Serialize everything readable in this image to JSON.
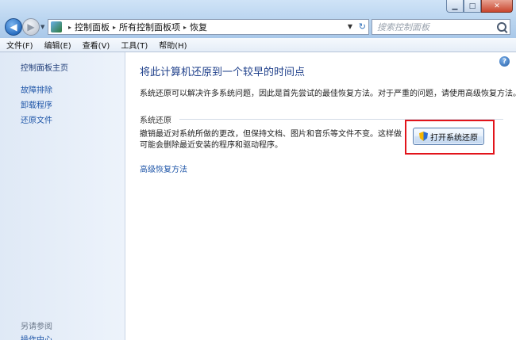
{
  "window": {
    "controls": {
      "minimize": "▁",
      "maximize": "□",
      "close": "✕"
    }
  },
  "address_bar": {
    "segments": [
      "控制面板",
      "所有控制面板项",
      "恢复"
    ],
    "separator": "▸"
  },
  "search": {
    "placeholder": "搜索控制面板"
  },
  "menu": [
    "文件(F)",
    "编辑(E)",
    "查看(V)",
    "工具(T)",
    "帮助(H)"
  ],
  "sidebar": {
    "home": "控制面板主页",
    "links": [
      "故障排除",
      "卸载程序",
      "还原文件"
    ],
    "see_also": "另请参阅",
    "bottom_link": "操作中心"
  },
  "main": {
    "title": "将此计算机还原到一个较早的时间点",
    "description": "系统还原可以解决许多系统问题，因此是首先尝试的最佳恢复方法。对于严重的问题，请使用高级恢复方法。",
    "section_title": "系统还原",
    "section_text": "撤销最近对系统所做的更改，但保持文档、图片和音乐等文件不变。这样做可能会删除最近安装的程序和驱动程序。",
    "button_label": "打开系统还原",
    "advanced_link": "高级恢复方法"
  },
  "colors": {
    "highlight_border": "#e2141b",
    "title_text": "#1e3f8a",
    "link_text": "#1f56a8"
  },
  "icons": {
    "back": "back-arrow-icon",
    "forward": "forward-arrow-icon",
    "address": "control-panel-icon",
    "search": "search-icon",
    "help": "help-icon",
    "uac": "uac-shield-icon"
  }
}
